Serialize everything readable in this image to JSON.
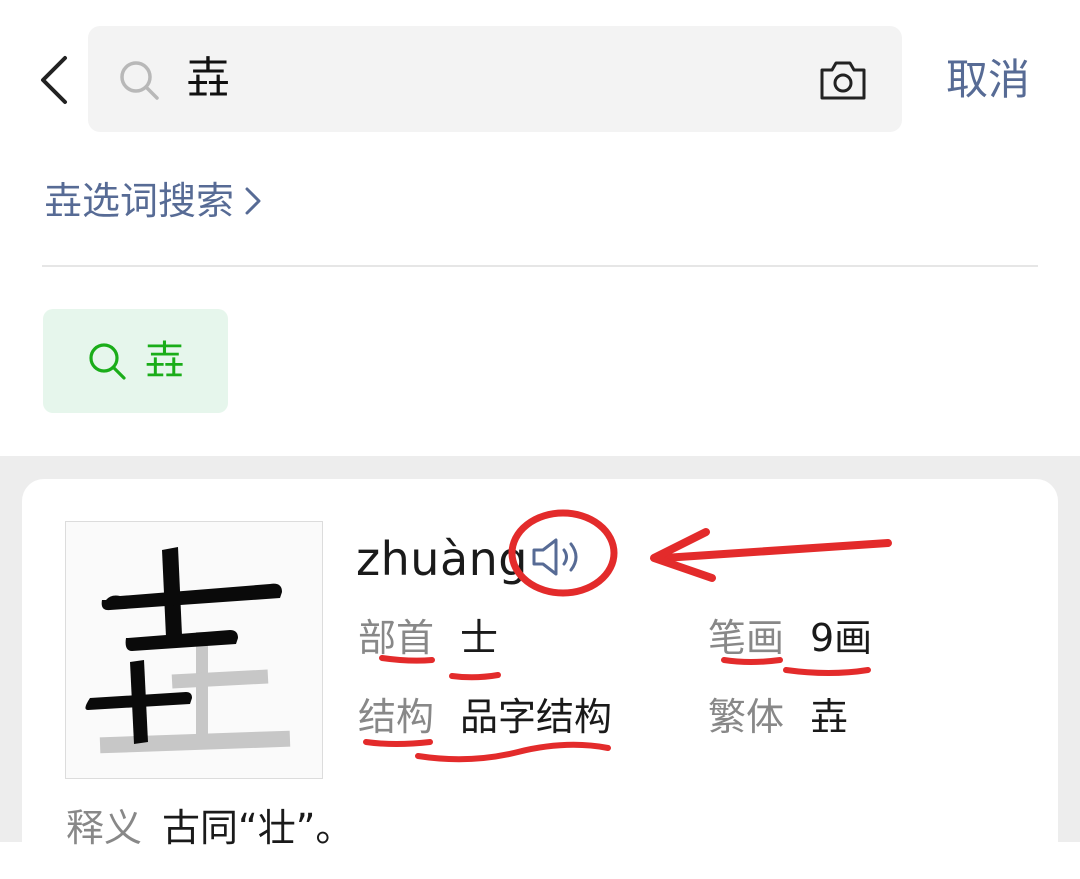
{
  "search": {
    "query": "壵",
    "cancel_label": "取消"
  },
  "suggest": {
    "label": "壵选词搜索"
  },
  "chip": {
    "label": "壵"
  },
  "entry": {
    "pinyin": "zhuàng",
    "radical_label": "部首",
    "radical_value": "士",
    "strokes_label": "笔画",
    "strokes_value": "9画",
    "structure_label": "结构",
    "structure_value": "品字结构",
    "traditional_label": "繁体",
    "traditional_value": "壵",
    "meaning_label": "释义",
    "meaning_value": "古同“壮”。"
  },
  "colors": {
    "link": "#576b95",
    "accent_green": "#1aad19",
    "chip_bg": "#e6f6ec",
    "annotation_red": "#e32b2b"
  },
  "icons": [
    "back-arrow-icon",
    "search-icon",
    "camera-icon",
    "chevron-right-icon",
    "speaker-icon"
  ]
}
